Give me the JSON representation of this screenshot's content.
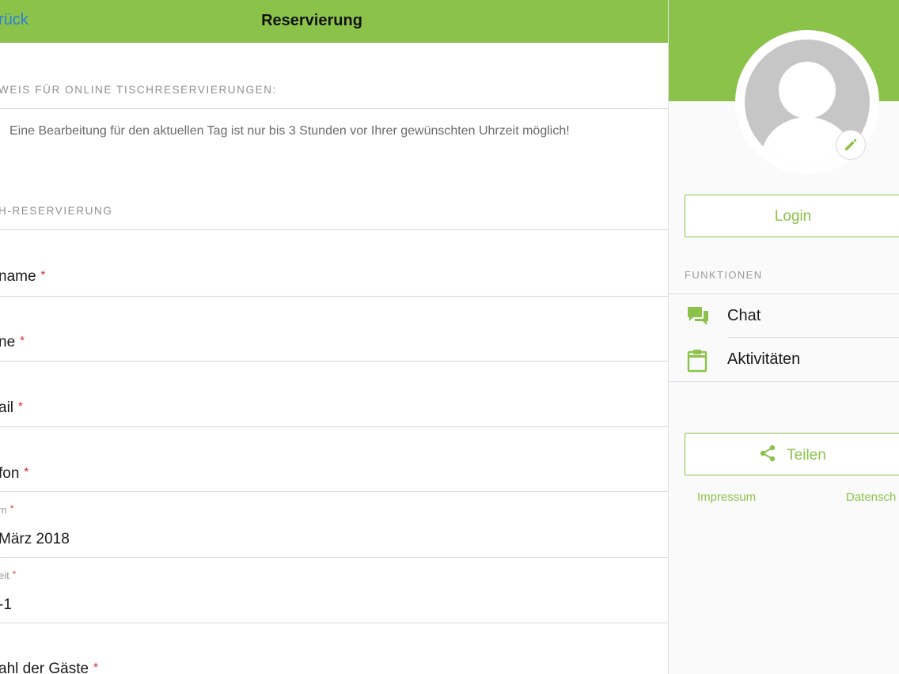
{
  "navbar": {
    "back_label": "rück",
    "title": "Reservierung"
  },
  "notice_section": {
    "header": "WEIS FÜR ONLINE TISCHRESERVIERUNGEN:",
    "text": "Eine Bearbeitung für den aktuellen Tag ist nur bis 3 Stunden vor Ihrer gewünschten Uhrzeit möglich!"
  },
  "form_section": {
    "header": "H-RESERVIERUNG",
    "required_marker": "*",
    "fields": [
      {
        "label": "name"
      },
      {
        "label": "ne"
      },
      {
        "label": "ail"
      },
      {
        "label": "fon"
      },
      {
        "label": "m",
        "value": "März 2018"
      },
      {
        "label": "eit",
        "value": "-1"
      },
      {
        "label": "ahl der Gäste"
      }
    ]
  },
  "sidebar": {
    "login_label": "Login",
    "functions_header": "FUNKTIONEN",
    "menu": [
      {
        "label": "Chat",
        "icon": "chat-icon"
      },
      {
        "label": "Aktivitäten",
        "icon": "clipboard-icon"
      }
    ],
    "share_label": "Teilen",
    "footer_links": [
      "Impressum",
      "Datensch"
    ]
  },
  "colors": {
    "accent": "#8bc34a",
    "link": "#2d7fd8",
    "required": "#e0282e"
  }
}
